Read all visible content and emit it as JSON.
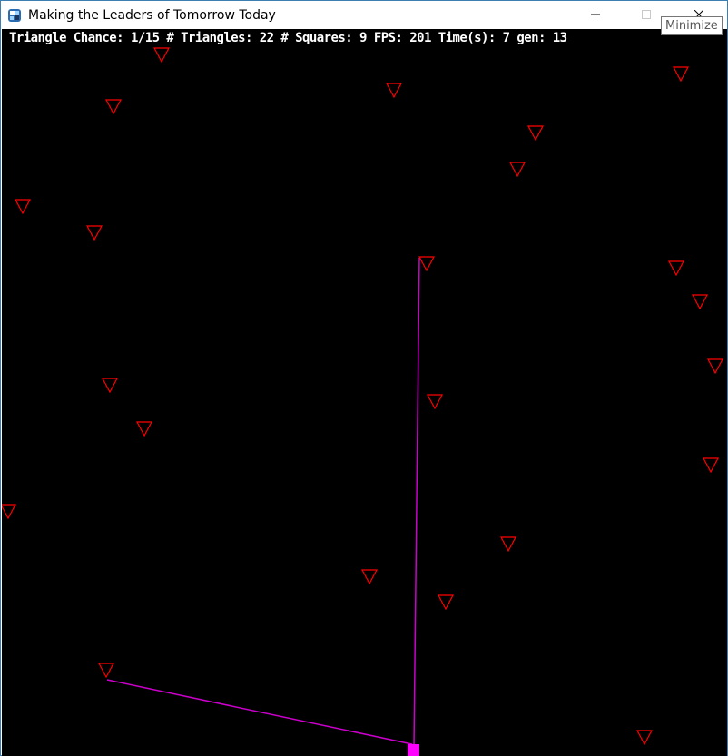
{
  "window": {
    "title": "Making the Leaders of Tomorrow Today",
    "tooltip": "Minimize",
    "icons": {
      "app": "app-icon",
      "minimize": "minimize-icon",
      "maximize": "maximize-icon",
      "close": "close-icon"
    }
  },
  "hud": {
    "text": "Triangle Chance: 1/15 # Triangles: 22 # Squares: 9 FPS: 201 Time(s): 7 gen: 13"
  },
  "colors": {
    "background": "#000000",
    "triangle": "#ff0000",
    "square": "#ff00ff",
    "path": "#cc00cc",
    "hud_text": "#ffffff"
  }
}
